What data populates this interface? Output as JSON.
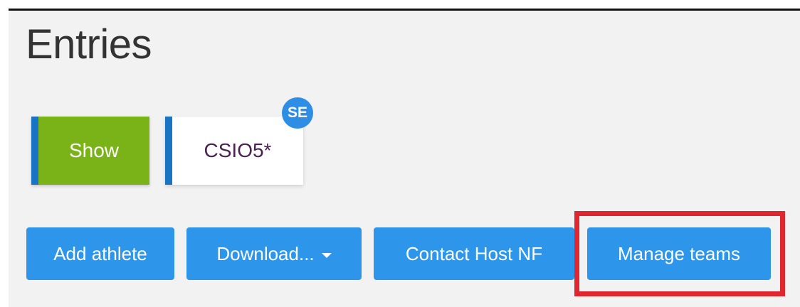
{
  "page": {
    "title": "Entries"
  },
  "tabs": [
    {
      "label": "Show",
      "active": true,
      "color": "#7ab317"
    },
    {
      "label": "CSIO5*",
      "active": false,
      "badge": "SE",
      "badge_color": "#2e8ee6"
    }
  ],
  "actions": {
    "add_athlete": "Add athlete",
    "download": "Download...",
    "download_icon": "caret-down-icon",
    "contact_host": "Contact Host NF",
    "manage_teams": "Manage teams"
  },
  "colors": {
    "button": "#2d96ea",
    "tab_accent": "#1a74c4",
    "highlight": "#e0262f"
  }
}
